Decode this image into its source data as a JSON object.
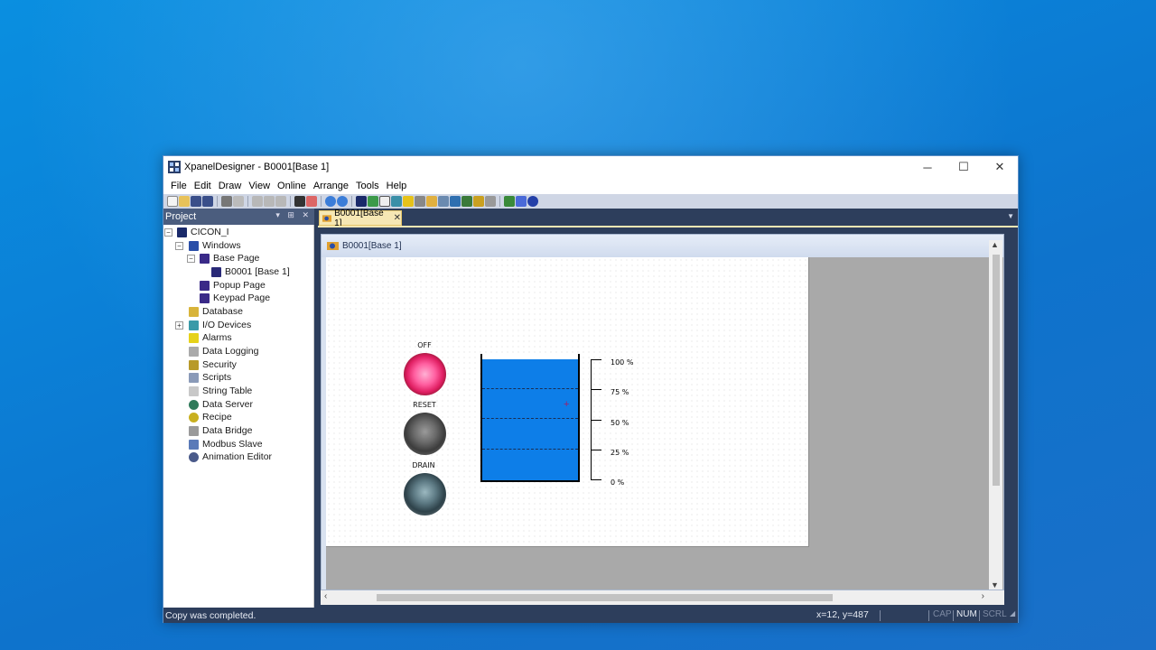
{
  "window": {
    "title": "XpanelDesigner - B0001[Base 1]",
    "minimize": "─",
    "maximize": "☐",
    "close": "✕"
  },
  "menu": [
    "File",
    "Edit",
    "Draw",
    "View",
    "Online",
    "Arrange",
    "Tools",
    "Help"
  ],
  "project_panel": {
    "title": "Project",
    "controls": "▾ ⊞ ✕",
    "tree": [
      {
        "label": "CICON_I",
        "icon": "project-icon"
      },
      {
        "label": "Windows",
        "icon": "windows-icon"
      },
      {
        "label": "Base Page",
        "icon": "base-page-icon"
      },
      {
        "label": "B0001 [Base 1]",
        "icon": "page-icon"
      },
      {
        "label": "Popup Page",
        "icon": "popup-page-icon"
      },
      {
        "label": "Keypad Page",
        "icon": "keypad-page-icon"
      },
      {
        "label": "Database",
        "icon": "database-icon"
      },
      {
        "label": "I/O Devices",
        "icon": "io-devices-icon"
      },
      {
        "label": "Alarms",
        "icon": "alarms-icon"
      },
      {
        "label": "Data Logging",
        "icon": "data-logging-icon"
      },
      {
        "label": "Security",
        "icon": "security-icon"
      },
      {
        "label": "Scripts",
        "icon": "scripts-icon"
      },
      {
        "label": "String Table",
        "icon": "string-table-icon"
      },
      {
        "label": "Data Server",
        "icon": "data-server-icon"
      },
      {
        "label": "Recipe",
        "icon": "recipe-icon"
      },
      {
        "label": "Data Bridge",
        "icon": "data-bridge-icon"
      },
      {
        "label": "Modbus Slave",
        "icon": "modbus-slave-icon"
      },
      {
        "label": "Animation Editor",
        "icon": "animation-editor-icon"
      }
    ]
  },
  "doc_tab": {
    "label": "B0001[Base 1]",
    "close": "✕"
  },
  "child_window": {
    "title": "B0001[Base 1]"
  },
  "canvas": {
    "buttons": [
      {
        "label": "OFF",
        "state": "red"
      },
      {
        "label": "RESET",
        "state": "gray"
      },
      {
        "label": "DRAIN",
        "state": "teal"
      }
    ],
    "tank": {
      "level_percent": 96,
      "color": "#0d7ee8"
    },
    "scale": [
      "100 %",
      "75 %",
      "50 %",
      "25 %",
      "0 %"
    ],
    "cross_marker": "+"
  },
  "statusbar": {
    "message": "Copy was completed.",
    "coords": "x=12, y=487",
    "cap": "CAP",
    "num": "NUM",
    "scrl": "SCRL"
  },
  "colors": {
    "titlebar": "#ffffff",
    "chrome_dark": "#2d3e5c",
    "tab_active": "#f6e7b4",
    "tank_water": "#0d7ee8"
  }
}
